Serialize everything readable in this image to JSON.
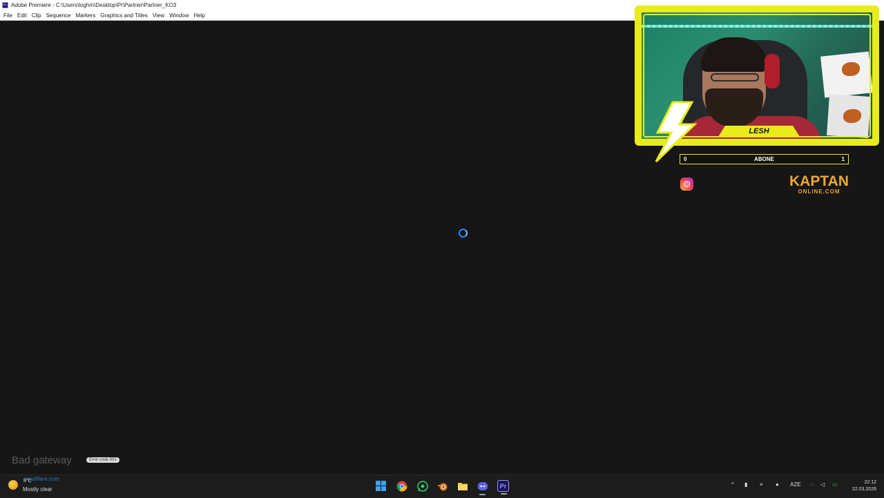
{
  "titlebar": {
    "app_icon": "Pr",
    "title": "Adobe Premiere - C:\\Users\\loghm\\Desktop\\Pr\\Partner\\Partner_KO3"
  },
  "menu": [
    "File",
    "Edit",
    "Clip",
    "Sequence",
    "Markers",
    "Graphics and Titles",
    "View",
    "Window",
    "Help"
  ],
  "overlay": {
    "streamer_name": "LESH",
    "sub_bar": {
      "current": "0",
      "label": "ABONE",
      "goal": "1"
    },
    "brand_top": "KAPTAN",
    "brand_bottom": "ONLINE.COM",
    "social_icon": "instagram-icon",
    "accent_color": "#e8ec1a",
    "brand_color": "#f0a830"
  },
  "notification": {
    "text": "Bad gateway",
    "badge": "Error code 503"
  },
  "taskbar": {
    "weather_temp": "8°C",
    "weather_desc": "Mostly clear",
    "cloud_link": "cloudflare.com",
    "apps": [
      "start-icon",
      "chrome-icon",
      "whatsapp-icon",
      "blender-icon",
      "file-explorer-icon",
      "discord-icon",
      "premiere-icon"
    ],
    "lang": "AZE",
    "time": "22:12",
    "date": "22.03.2026"
  }
}
